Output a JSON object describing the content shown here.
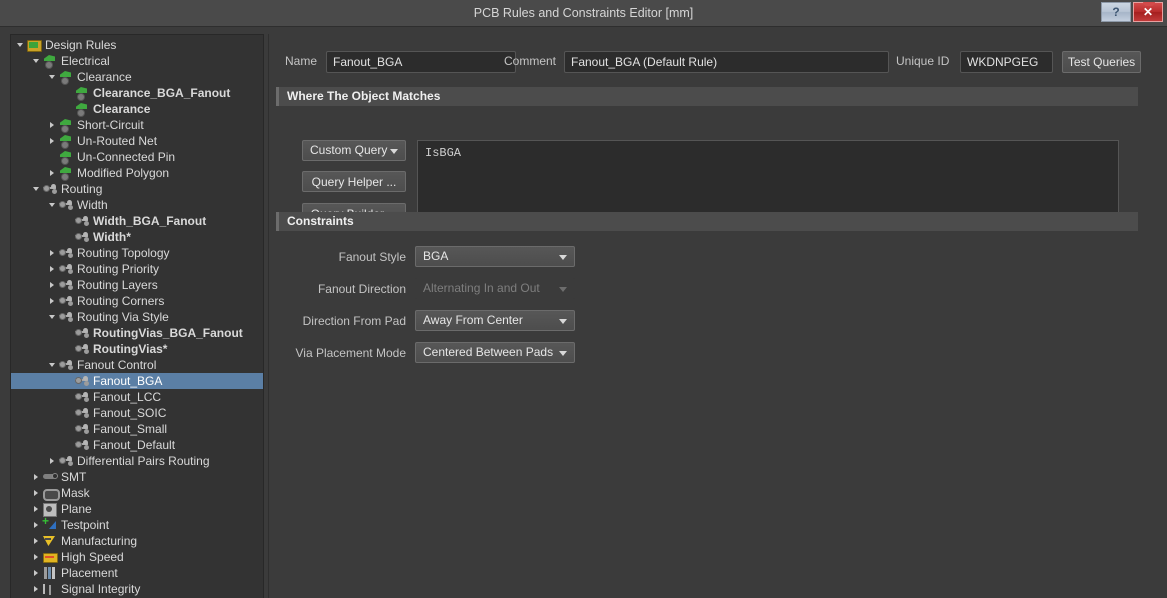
{
  "window": {
    "title": "PCB Rules and Constraints Editor [mm]",
    "help_label": "?",
    "close_label": "✕"
  },
  "tree": {
    "items": [
      {
        "label": "Design Rules",
        "indent": 0,
        "arrow": "open",
        "icon": "folder",
        "bold": false,
        "selected": false
      },
      {
        "label": "Electrical",
        "indent": 1,
        "arrow": "open",
        "icon": "elec",
        "bold": false,
        "selected": false
      },
      {
        "label": "Clearance",
        "indent": 2,
        "arrow": "open",
        "icon": "elec",
        "bold": false,
        "selected": false
      },
      {
        "label": "Clearance_BGA_Fanout",
        "indent": 3,
        "arrow": "none",
        "icon": "elec",
        "bold": true,
        "selected": false
      },
      {
        "label": "Clearance",
        "indent": 3,
        "arrow": "none",
        "icon": "elec",
        "bold": true,
        "selected": false
      },
      {
        "label": "Short-Circuit",
        "indent": 2,
        "arrow": "closed",
        "icon": "elec",
        "bold": false,
        "selected": false
      },
      {
        "label": "Un-Routed Net",
        "indent": 2,
        "arrow": "closed",
        "icon": "elec",
        "bold": false,
        "selected": false
      },
      {
        "label": "Un-Connected Pin",
        "indent": 2,
        "arrow": "none",
        "icon": "elec",
        "bold": false,
        "selected": false
      },
      {
        "label": "Modified Polygon",
        "indent": 2,
        "arrow": "closed",
        "icon": "elec",
        "bold": false,
        "selected": false
      },
      {
        "label": "Routing",
        "indent": 1,
        "arrow": "open",
        "icon": "route",
        "bold": false,
        "selected": false
      },
      {
        "label": "Width",
        "indent": 2,
        "arrow": "open",
        "icon": "route",
        "bold": false,
        "selected": false
      },
      {
        "label": "Width_BGA_Fanout",
        "indent": 3,
        "arrow": "none",
        "icon": "route",
        "bold": true,
        "selected": false
      },
      {
        "label": "Width*",
        "indent": 3,
        "arrow": "none",
        "icon": "route",
        "bold": true,
        "selected": false
      },
      {
        "label": "Routing Topology",
        "indent": 2,
        "arrow": "closed",
        "icon": "route",
        "bold": false,
        "selected": false
      },
      {
        "label": "Routing Priority",
        "indent": 2,
        "arrow": "closed",
        "icon": "route",
        "bold": false,
        "selected": false
      },
      {
        "label": "Routing Layers",
        "indent": 2,
        "arrow": "closed",
        "icon": "route",
        "bold": false,
        "selected": false
      },
      {
        "label": "Routing Corners",
        "indent": 2,
        "arrow": "closed",
        "icon": "route",
        "bold": false,
        "selected": false
      },
      {
        "label": "Routing Via Style",
        "indent": 2,
        "arrow": "open",
        "icon": "route",
        "bold": false,
        "selected": false
      },
      {
        "label": "RoutingVias_BGA_Fanout",
        "indent": 3,
        "arrow": "none",
        "icon": "route",
        "bold": true,
        "selected": false
      },
      {
        "label": "RoutingVias*",
        "indent": 3,
        "arrow": "none",
        "icon": "route",
        "bold": true,
        "selected": false
      },
      {
        "label": "Fanout Control",
        "indent": 2,
        "arrow": "open",
        "icon": "route",
        "bold": false,
        "selected": false
      },
      {
        "label": "Fanout_BGA",
        "indent": 3,
        "arrow": "none",
        "icon": "route",
        "bold": false,
        "selected": true
      },
      {
        "label": "Fanout_LCC",
        "indent": 3,
        "arrow": "none",
        "icon": "route",
        "bold": false,
        "selected": false
      },
      {
        "label": "Fanout_SOIC",
        "indent": 3,
        "arrow": "none",
        "icon": "route",
        "bold": false,
        "selected": false
      },
      {
        "label": "Fanout_Small",
        "indent": 3,
        "arrow": "none",
        "icon": "route",
        "bold": false,
        "selected": false
      },
      {
        "label": "Fanout_Default",
        "indent": 3,
        "arrow": "none",
        "icon": "route",
        "bold": false,
        "selected": false
      },
      {
        "label": "Differential Pairs Routing",
        "indent": 2,
        "arrow": "closed",
        "icon": "route",
        "bold": false,
        "selected": false
      },
      {
        "label": "SMT",
        "indent": 1,
        "arrow": "closed",
        "icon": "smt",
        "bold": false,
        "selected": false
      },
      {
        "label": "Mask",
        "indent": 1,
        "arrow": "closed",
        "icon": "mask",
        "bold": false,
        "selected": false
      },
      {
        "label": "Plane",
        "indent": 1,
        "arrow": "closed",
        "icon": "plane",
        "bold": false,
        "selected": false
      },
      {
        "label": "Testpoint",
        "indent": 1,
        "arrow": "closed",
        "icon": "testpoint",
        "bold": false,
        "selected": false
      },
      {
        "label": "Manufacturing",
        "indent": 1,
        "arrow": "closed",
        "icon": "manuf",
        "bold": false,
        "selected": false
      },
      {
        "label": "High Speed",
        "indent": 1,
        "arrow": "closed",
        "icon": "hs",
        "bold": false,
        "selected": false
      },
      {
        "label": "Placement",
        "indent": 1,
        "arrow": "closed",
        "icon": "place",
        "bold": false,
        "selected": false
      },
      {
        "label": "Signal Integrity",
        "indent": 1,
        "arrow": "closed",
        "icon": "si",
        "bold": false,
        "selected": false
      }
    ]
  },
  "form": {
    "name_label": "Name",
    "name_value": "Fanout_BGA",
    "comment_label": "Comment",
    "comment_value": "Fanout_BGA (Default Rule)",
    "unique_id_label": "Unique ID",
    "unique_id_value": "WKDNPGEG",
    "test_queries_label": "Test Queries"
  },
  "where_section": {
    "title": "Where The Object Matches",
    "scope_value": "Custom Query",
    "query_helper_label": "Query Helper ...",
    "query_builder_label": "Query Builder ...",
    "query_text": "IsBGA"
  },
  "constraints_section": {
    "title": "Constraints",
    "rows": [
      {
        "label": "Fanout Style",
        "value": "BGA",
        "disabled": false
      },
      {
        "label": "Fanout Direction",
        "value": "Alternating In and Out",
        "disabled": true
      },
      {
        "label": "Direction From Pad",
        "value": "Away From Center",
        "disabled": false
      },
      {
        "label": "Via Placement Mode",
        "value": "Centered Between Pads",
        "disabled": false
      }
    ]
  },
  "colors": {
    "window_bg": "#3b3b3b",
    "panel_bg": "#333333",
    "selection": "#5b7fa5",
    "section_head": "#4c4c4c",
    "close_button": "#b92c2c",
    "text": "#d9d9d9"
  }
}
